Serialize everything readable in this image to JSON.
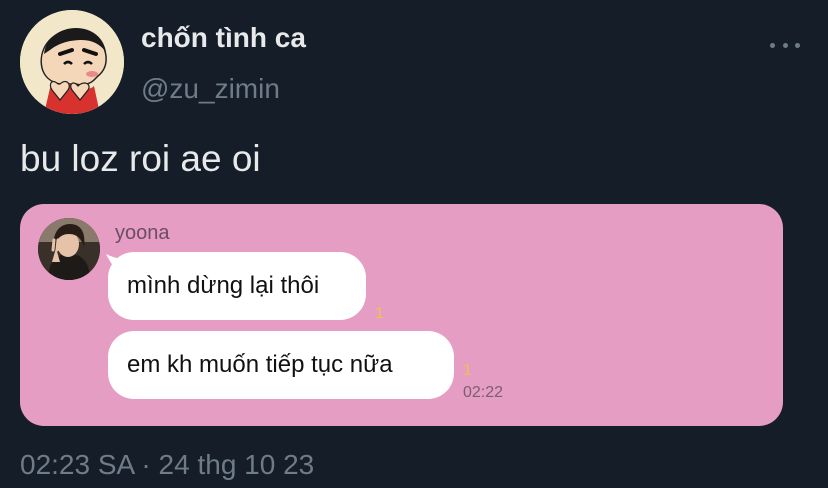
{
  "author": {
    "display_name": "chốn tình ca",
    "handle": "@zu_zimin",
    "avatar_icon": "crayon-shinchan-avatar"
  },
  "menu": {
    "more_icon": "more-horizontal-icon"
  },
  "tweet": {
    "text": "bu loz roi ae oi",
    "timestamp": "02:23 SA · 24 thg 10 23"
  },
  "media": {
    "background_color": "#e59dc3",
    "chat": {
      "sender_name": "yoona",
      "avatar_icon": "user-photo-avatar",
      "messages": [
        {
          "text": "mình dừng lại thôi",
          "read_count": "1"
        },
        {
          "text": "em kh muốn tiếp tục nữa",
          "read_count": "1",
          "time": "02:22"
        }
      ]
    }
  },
  "colors": {
    "background": "#151d28",
    "text_primary": "#e7e9ea",
    "text_secondary": "#6e7b88",
    "read_indicator": "#f0c24b"
  }
}
